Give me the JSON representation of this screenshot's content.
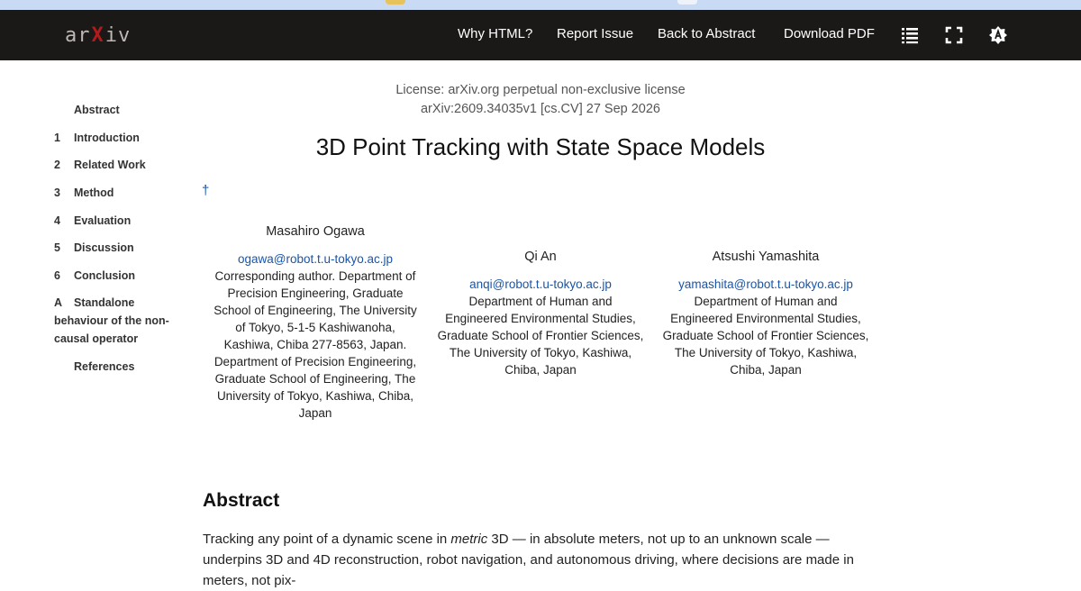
{
  "nav": {
    "logo_text": "arXiv",
    "links": [
      "Why HTML?",
      "Report Issue",
      "Back to Abstract",
      "Download PDF"
    ],
    "icons": [
      "list-icon",
      "fullscreen-icon",
      "theme-toggle-icon"
    ]
  },
  "toc": {
    "items": [
      {
        "num": "",
        "label": "Abstract"
      },
      {
        "num": "1",
        "label": "Introduction"
      },
      {
        "num": "2",
        "label": "Related Work"
      },
      {
        "num": "3",
        "label": "Method"
      },
      {
        "num": "4",
        "label": "Evaluation"
      },
      {
        "num": "5",
        "label": "Discussion"
      },
      {
        "num": "6",
        "label": "Conclusion"
      },
      {
        "num": "A",
        "label": "Standalone behaviour of the non-causal operator"
      },
      {
        "num": "",
        "label": "References"
      }
    ]
  },
  "paper": {
    "license": "License: arXiv.org perpetual non-exclusive license",
    "id_line": "arXiv:2609.34035v1 [cs.CV] 27 Sep 2026",
    "title": "3D Point Tracking with State Space Models",
    "dagger": "†",
    "authors": [
      {
        "name": "Masahiro Ogawa",
        "email": "ogawa@robot.t.u-tokyo.ac.jp",
        "affiliation": "Corresponding author. Department of Precision Engineering, Graduate School of Engineering, The University of Tokyo, 5-1-5 Kashiwanoha, Kashiwa, Chiba 277-8563, Japan. Department of Precision Engineering, Graduate School of Engineering, The University of Tokyo, Kashiwa, Chiba, Japan"
      },
      {
        "name": "Qi An",
        "email": "anqi@robot.t.u-tokyo.ac.jp",
        "affiliation": "Department of Human and Engineered Environmental Studies, Graduate School of Frontier Sciences, The University of Tokyo, Kashiwa, Chiba, Japan"
      },
      {
        "name": "Atsushi Yamashita",
        "email": "yamashita@robot.t.u-tokyo.ac.jp",
        "affiliation": "Department of Human and Engineered Environmental Studies, Graduate School of Frontier Sciences, The University of Tokyo, Kashiwa, Chiba, Japan"
      }
    ],
    "abstract_heading": "Abstract",
    "abstract_pre": "Tracking any point of a dynamic scene in ",
    "abstract_em": "metric",
    "abstract_post": " 3D — in absolute meters, not up to an unknown scale — underpins 3D and 4D reconstruction, robot navigation, and autonomous driving, where decisions are made in meters, not pix-"
  },
  "colors": {
    "navbar_bg": "#1b1918",
    "link_blue": "#1a55a8",
    "logo_x": "#b31b1b"
  }
}
